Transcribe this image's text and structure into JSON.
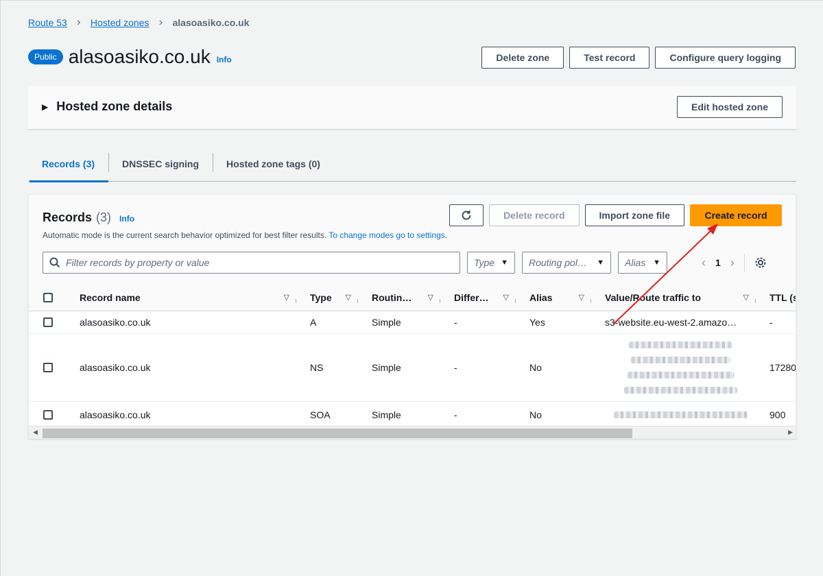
{
  "breadcrumb": {
    "items": [
      "Route 53",
      "Hosted zones"
    ],
    "current": "alasoasiko.co.uk"
  },
  "header": {
    "badge": "Public",
    "title": "alasoasiko.co.uk",
    "info": "Info",
    "actions": [
      "Delete zone",
      "Test record",
      "Configure query logging"
    ]
  },
  "details": {
    "title": "Hosted zone details",
    "edit_label": "Edit hosted zone"
  },
  "tabs": [
    {
      "label": "Records (3)",
      "active": true
    },
    {
      "label": "DNSSEC signing",
      "active": false
    },
    {
      "label": "Hosted zone tags (0)",
      "active": false
    }
  ],
  "records": {
    "title": "Records",
    "count": "(3)",
    "info": "Info",
    "description": "Automatic mode is the current search behavior optimized for best filter results.",
    "description_link": "To change modes go to settings.",
    "actions": {
      "delete": "Delete record",
      "import": "Import zone file",
      "create": "Create record"
    },
    "search_placeholder": "Filter records by property or value",
    "filters": [
      "Type",
      "Routing pol…",
      "Alias"
    ],
    "page": "1",
    "columns": [
      "Record name",
      "Type",
      "Routin…",
      "Differ…",
      "Alias",
      "Value/Route traffic to",
      "TTL (s"
    ],
    "rows": [
      {
        "name": "alasoasiko.co.uk",
        "type": "A",
        "routing": "Simple",
        "differ": "-",
        "alias": "Yes",
        "value": "s3-website.eu-west-2.amazo…",
        "ttl": "-"
      },
      {
        "name": "alasoasiko.co.uk",
        "type": "NS",
        "routing": "Simple",
        "differ": "-",
        "alias": "No",
        "value": "",
        "ttl": "17280"
      },
      {
        "name": "alasoasiko.co.uk",
        "type": "SOA",
        "routing": "Simple",
        "differ": "-",
        "alias": "No",
        "value": "",
        "ttl": "900"
      }
    ]
  },
  "colors": {
    "accent": "#0972d3",
    "primary_button": "#ff9900",
    "annotation_arrow": "#e02020"
  }
}
